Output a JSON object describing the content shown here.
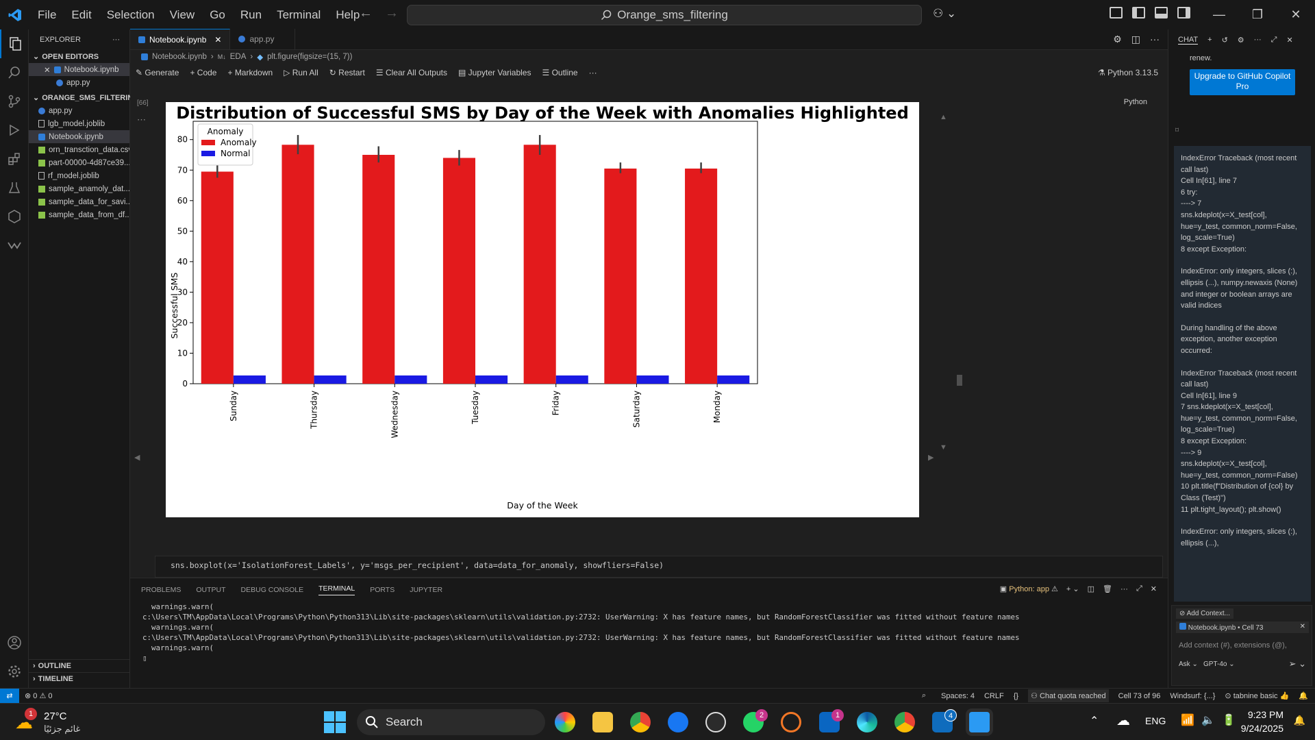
{
  "menu": [
    "File",
    "Edit",
    "Selection",
    "View",
    "Go",
    "Run",
    "Terminal",
    "Help"
  ],
  "search_box": "Orange_sms_filtering",
  "explorer": {
    "title": "EXPLORER",
    "open_editors": "OPEN EDITORS",
    "open_files": [
      "Notebook.ipynb",
      "app.py"
    ],
    "project": "ORANGE_SMS_FILTERING",
    "files": [
      "app.py",
      "lgb_model.joblib",
      "Notebook.ipynb",
      "orn_transction_data.csv",
      "part-00000-4d87ce39...",
      "rf_model.joblib",
      "sample_anamoly_dat...",
      "sample_data_for_savi...",
      "sample_data_from_df..."
    ],
    "outline": "OUTLINE",
    "timeline": "TIMELINE"
  },
  "tabs": [
    "Notebook.ipynb",
    "app.py"
  ],
  "breadcrumb": [
    "Notebook.ipynb",
    "EDA",
    "plt.figure(figsize=(15, 7))"
  ],
  "nb_toolbar": {
    "generate": "Generate",
    "code": "Code",
    "markdown": "Markdown",
    "run_all": "Run All",
    "restart": "Restart",
    "clear": "Clear All Outputs",
    "variables": "Jupyter Variables",
    "outline": "Outline",
    "kernel": "Python 3.13.5",
    "lang": "Python",
    "exec_count": "[66]"
  },
  "chart_data": {
    "type": "bar",
    "title": "Distribution of Successful SMS by Day of the Week with Anomalies Highlighted",
    "xlabel": "Day of the Week",
    "ylabel": "Successful SMS",
    "ylim": [
      0,
      86
    ],
    "yticks": [
      0,
      10,
      20,
      30,
      40,
      50,
      60,
      70,
      80
    ],
    "categories": [
      "Sunday",
      "Thursday",
      "Wednesday",
      "Tuesday",
      "Friday",
      "Saturday",
      "Monday"
    ],
    "legend_title": "Anomaly",
    "legend_position": "top-left",
    "series": [
      {
        "name": "Anomaly",
        "color": "#e31a1c",
        "values": [
          69.5,
          78.3,
          75.0,
          74.0,
          78.3,
          70.5,
          70.5
        ],
        "err_low": [
          67.5,
          75.2,
          72.5,
          71.5,
          75.0,
          69.0,
          69.0
        ],
        "err_high": [
          71.7,
          81.5,
          77.8,
          76.6,
          81.5,
          72.5,
          72.5
        ]
      },
      {
        "name": "Normal",
        "color": "#1a1ae3",
        "values": [
          2.7,
          2.7,
          2.7,
          2.7,
          2.7,
          2.7,
          2.7
        ]
      }
    ]
  },
  "code_line": "sns.boxplot(x='IsolationForest_Labels', y='msgs_per_recipient', data=data_for_anomaly, showfliers=False)",
  "panel": {
    "tabs": [
      "PROBLEMS",
      "OUTPUT",
      "DEBUG CONSOLE",
      "TERMINAL",
      "PORTS",
      "JUPYTER"
    ],
    "shell": "Python: app",
    "terminal": [
      "  warnings.warn(",
      "c:\\Users\\TM\\AppData\\Local\\Programs\\Python\\Python313\\Lib\\site-packages\\sklearn\\utils\\validation.py:2732: UserWarning: X has feature names, but RandomForestClassifier was fitted without feature names",
      "  warnings.warn(",
      "c:\\Users\\TM\\AppData\\Local\\Programs\\Python\\Python313\\Lib\\site-packages\\sklearn\\utils\\validation.py:2732: UserWarning: X has feature names, but RandomForestClassifier was fitted without feature names",
      "  warnings.warn(",
      "▯"
    ]
  },
  "chat": {
    "title": "CHAT",
    "renew": "renew.",
    "upgrade": "Upgrade to GitHub Copilot Pro",
    "messages": [
      "IndexError Traceback (most recent call last)\nCell In[61], line 7\n6 try:\n----> 7\nsns.kdeplot(x=X_test[col], hue=y_test, common_norm=False, log_scale=True)\n8 except Exception:",
      "IndexError: only integers, slices (:), ellipsis (...), numpy.newaxis (None) and integer or boolean arrays are valid indices",
      "During handling of the above exception, another exception occurred:",
      "IndexError Traceback (most recent call last)\nCell In[61], line 9\n7 sns.kdeplot(x=X_test[col], hue=y_test, common_norm=False, log_scale=True)\n8 except Exception:\n----> 9\nsns.kdeplot(x=X_test[col], hue=y_test, common_norm=False)\n10 plt.title(f\"Distribution of {col} by Class (Test)\")\n11 plt.tight_layout(); plt.show()",
      "IndexError: only integers, slices (:), ellipsis (...),"
    ],
    "add_context": "Add Context...",
    "context_file": "Notebook.ipynb • Cell 73",
    "placeholder": "Add context (#), extensions (@),",
    "mode": "Ask",
    "model": "GPT-4o"
  },
  "status": {
    "errors": "⊗ 0 ⚠ 0",
    "spaces": "Spaces: 4",
    "eol": "CRLF",
    "quota": "Chat quota reached",
    "cell": "Cell 73 of 96",
    "windsurf": "Windsurf: {...}",
    "tabnine": "tabnine basic"
  },
  "taskbar": {
    "temp": "27°C",
    "weather": "غائم جزئيًا",
    "search": "Search",
    "lang": "ENG",
    "time": "9:23 PM",
    "date": "9/24/2025",
    "badges": [
      "2",
      "1",
      "4"
    ]
  }
}
